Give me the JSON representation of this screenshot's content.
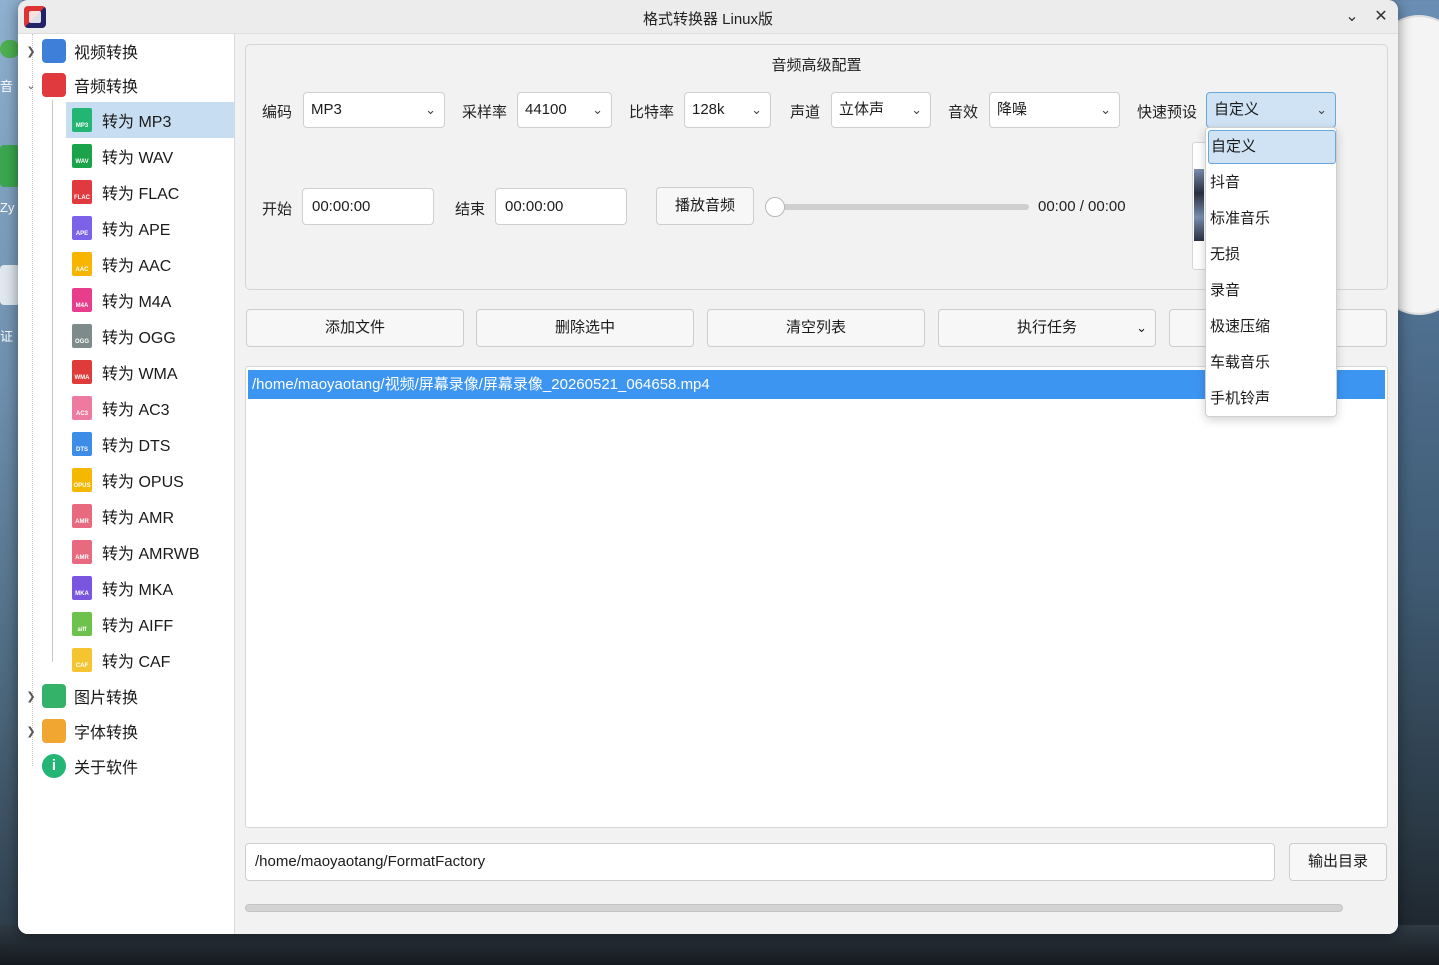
{
  "window": {
    "title": "格式转换器 Linux版"
  },
  "desktop": {
    "left_labels": [
      "音",
      "Zy",
      "证"
    ]
  },
  "sidebar": {
    "categories": [
      {
        "label": "视频转换",
        "expanded": false
      },
      {
        "label": "音频转换",
        "expanded": true
      },
      {
        "label": "图片转换",
        "expanded": false
      },
      {
        "label": "字体转换",
        "expanded": false
      },
      {
        "label": "关于软件",
        "expanded": false
      }
    ],
    "audio_items": [
      {
        "label": "转为 MP3",
        "tag": "MP3",
        "color": "#22b573",
        "selected": true
      },
      {
        "label": "转为 WAV",
        "tag": "WAV",
        "color": "#1aa34a"
      },
      {
        "label": "转为 FLAC",
        "tag": "FLAC",
        "color": "#e0393e"
      },
      {
        "label": "转为 APE",
        "tag": "APE",
        "color": "#7b62e8"
      },
      {
        "label": "转为 AAC",
        "tag": "AAC",
        "color": "#f7b500"
      },
      {
        "label": "转为 M4A",
        "tag": "M4A",
        "color": "#e83d8a"
      },
      {
        "label": "转为 OGG",
        "tag": "OGG",
        "color": "#7d8c8a"
      },
      {
        "label": "转为 WMA",
        "tag": "WMA",
        "color": "#e03b3b"
      },
      {
        "label": "转为 AC3",
        "tag": "AC3",
        "color": "#ef7aa0"
      },
      {
        "label": "转为 DTS",
        "tag": "DTS",
        "color": "#3d8de8"
      },
      {
        "label": "转为 OPUS",
        "tag": "OPUS",
        "color": "#f5b800"
      },
      {
        "label": "转为 AMR",
        "tag": "AMR",
        "color": "#e86a7e"
      },
      {
        "label": "转为 AMRWB",
        "tag": "AMR",
        "color": "#e86a7e"
      },
      {
        "label": "转为 MKA",
        "tag": "MKA",
        "color": "#7a55e0"
      },
      {
        "label": "转为 AIFF",
        "tag": "aiff",
        "color": "#6cc24a"
      },
      {
        "label": "转为 CAF",
        "tag": "CAF",
        "color": "#f4c431"
      }
    ]
  },
  "config": {
    "group_title": "音频高级配置",
    "codec_label": "编码",
    "codec_value": "MP3",
    "samplerate_label": "采样率",
    "samplerate_value": "44100",
    "bitrate_label": "比特率",
    "bitrate_value": "128k",
    "channel_label": "声道",
    "channel_value": "立体声",
    "effect_label": "音效",
    "effect_value": "降噪",
    "preset_label": "快速预设",
    "preset_value": "自定义",
    "start_label": "开始",
    "start_value": "00:00:00",
    "end_label": "结束",
    "end_value": "00:00:00",
    "play_button": "播放音频",
    "time_display": "00:00 / 00:00",
    "playback_progress": 0
  },
  "preset_options": [
    "自定义",
    "抖音",
    "标准音乐",
    "无损",
    "录音",
    "极速压缩",
    "车载音乐",
    "手机铃声"
  ],
  "toolbar": {
    "add_file": "添加文件",
    "delete_selected": "删除选中",
    "clear_list": "清空列表",
    "run_task": "执行任务"
  },
  "file_list": [
    "/home/maoyaotang/视频/屏幕录像/屏幕录像_20260521_064658.mp4"
  ],
  "output": {
    "path": "/home/maoyaotang/FormatFactory",
    "button": "输出目录"
  },
  "conversion_progress": 0
}
